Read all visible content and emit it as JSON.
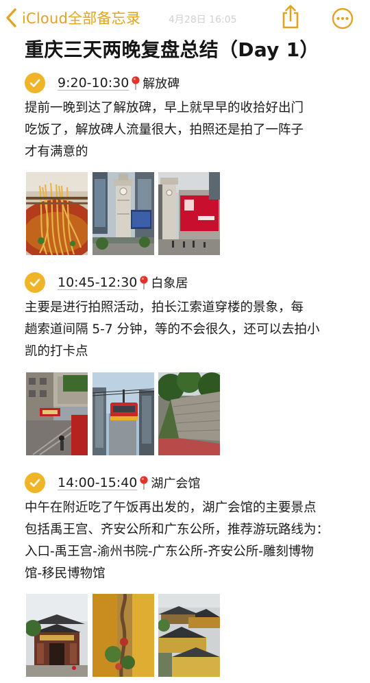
{
  "nav": {
    "back_label": "iCloud全部备忘录",
    "date_text": "4月28日 16:05"
  },
  "title": "重庆三天两晚复盘总结（Day 1）",
  "sections": [
    {
      "time": "9:20-10:30",
      "place": "解放碑",
      "lines": [
        "提前一晚到达了解放碑，早上就早早的收拾好出门",
        "吃饭了，解放碑人流量很大，拍照还是拍了一阵子",
        "才有满意的"
      ]
    },
    {
      "time": "10:45-12:30",
      "place": "白象居",
      "lines": [
        "主要是进行拍照活动，拍长江索道穿楼的景象，每",
        "趟索道间隔 5-7 分钟，等的不会很久，还可以去拍小",
        "凯的打卡点"
      ]
    },
    {
      "time": "14:00-15:40",
      "place": "湖广会馆",
      "lines": [
        "中午在附近吃了午饭再出发的，湖广会馆的主要景点",
        "包括禹王宫、齐安公所和广东公所，推荐游玩路线为：",
        "入口-禹王宫-渝州书院-广东公所-齐安公所-雕刻博物",
        "馆-移民博物馆"
      ]
    }
  ],
  "colors": {
    "accent": "#e2a321",
    "check": "#f0b429",
    "pin": "#e0342b"
  },
  "icons": {
    "back": "chevron-left-icon",
    "share": "share-icon",
    "more": "ellipsis-circle-icon",
    "check": "checkmark-circle-icon",
    "pin": "map-pin-icon"
  }
}
